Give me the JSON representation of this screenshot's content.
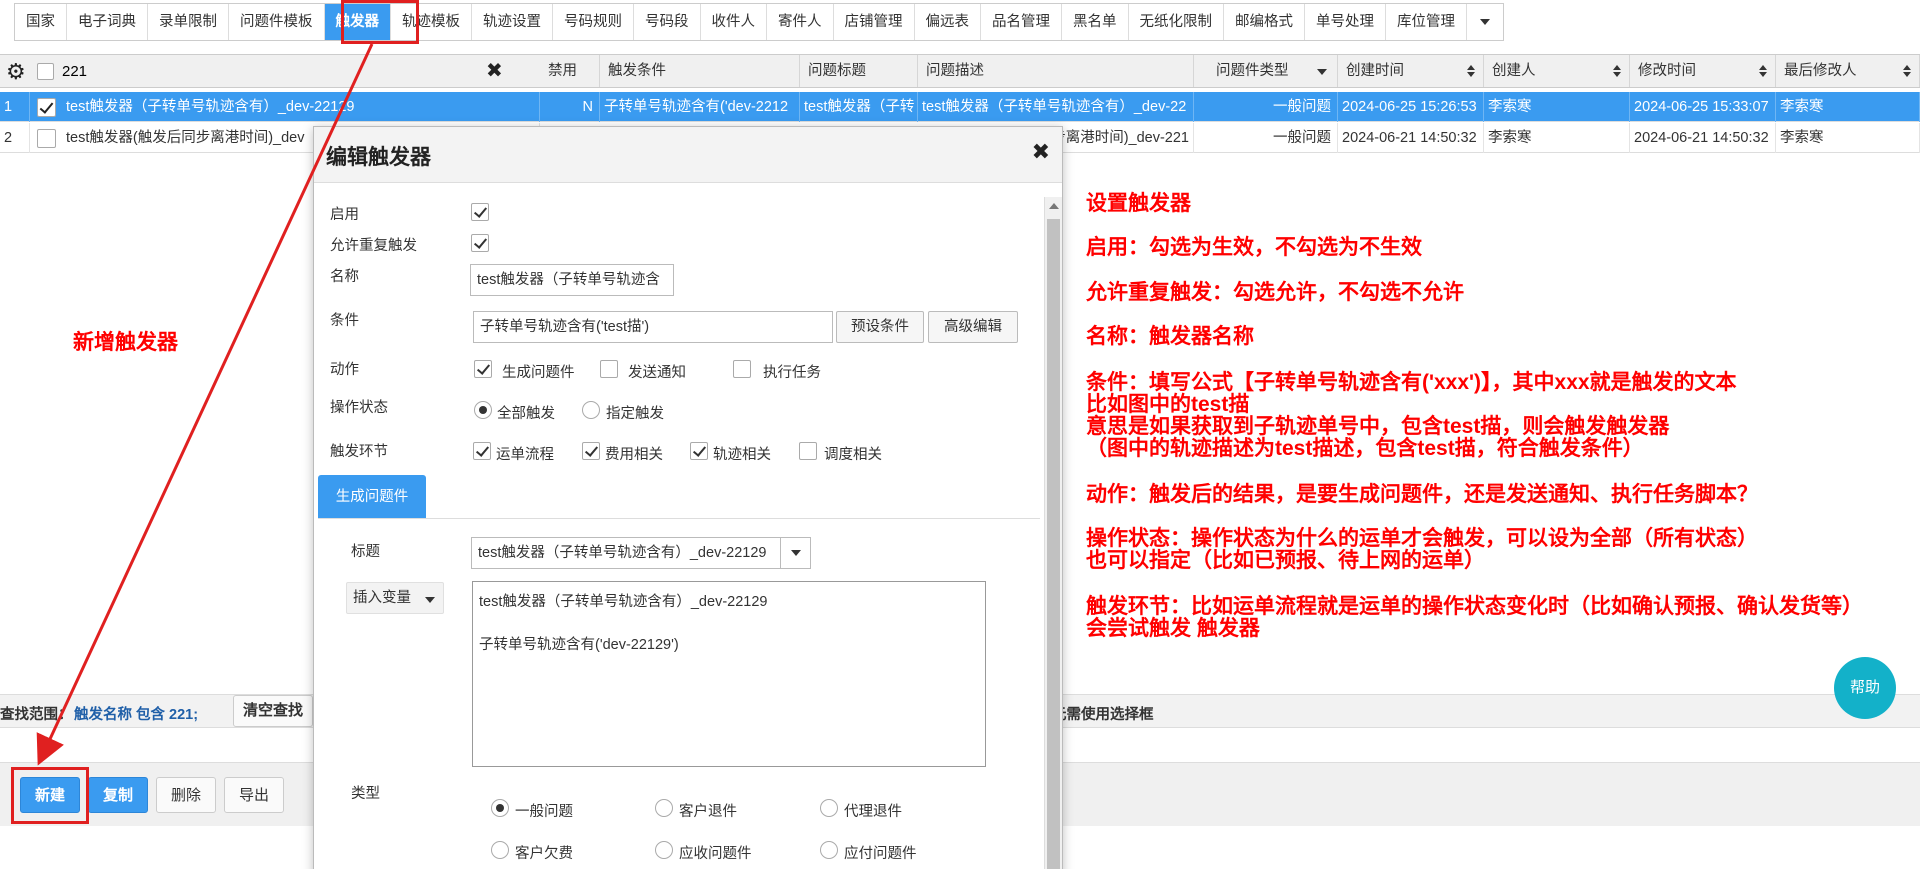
{
  "tabs": [
    "国家",
    "电子词典",
    "录单限制",
    "问题件模板",
    "触发器",
    "轨迹模板",
    "轨迹设置",
    "号码规则",
    "号码段",
    "收件人",
    "寄件人",
    "店铺管理",
    "偏远表",
    "品名管理",
    "黑名单",
    "无纸化限制",
    "邮编格式",
    "单号处理",
    "库位管理"
  ],
  "active_tab": "触发器",
  "table": {
    "search_value": "221",
    "headers": {
      "disabled": "禁用",
      "condition": "触发条件",
      "issue_title": "问题标题",
      "issue_desc": "问题描述",
      "issue_type": "问题件类型",
      "created_time": "创建时间",
      "creator": "创建人",
      "modified_time": "修改时间",
      "last_modifier": "最后修改人"
    },
    "rows": [
      {
        "num": "1",
        "name": "test触发器（子转单号轨迹含有）_dev-22129",
        "disabled": "N",
        "condition": "子转单号轨迹含有('dev-2212",
        "title": "test触发器（子转",
        "desc": "test触发器（子转单号轨迹含有）_dev-22",
        "type": "一般问题",
        "created": "2024-06-25 15:26:53",
        "creator": "李索寒",
        "modified": "2024-06-25 15:33:07",
        "modifier": "李索寒"
      },
      {
        "num": "2",
        "name": "test触发器(触发后同步离港时间)_dev",
        "disabled": "",
        "condition": "",
        "title": "",
        "desc": "步离港时间)_dev-221",
        "type": "一般问题",
        "created": "2024-06-21 14:50:32",
        "creator": "李索寒",
        "modified": "2024-06-21 14:50:32",
        "modifier": "李索寒"
      }
    ]
  },
  "filter": {
    "label": "查找范围：",
    "value": "触发名称 包含 221;",
    "clear_button": "清空查找",
    "tail_text": "元需使用选择框"
  },
  "actions": {
    "new": "新建",
    "copy": "复制",
    "delete": "删除",
    "export": "导出"
  },
  "help": "帮助",
  "modal": {
    "title": "编辑触发器",
    "enable_label": "启用",
    "repeat_label": "允许重复触发",
    "name_label": "名称",
    "name_value": "test触发器（子转单号轨迹含",
    "condition_label": "条件",
    "condition_value": "子转单号轨迹含有('test描')",
    "preset_button": "预设条件",
    "advanced_button": "高级编辑",
    "action_label": "动作",
    "action_options": [
      "生成问题件",
      "发送通知",
      "执行任务"
    ],
    "op_state_label": "操作状态",
    "op_state_options": [
      "全部触发",
      "指定触发"
    ],
    "stage_label": "触发环节",
    "stage_options": [
      "运单流程",
      "费用相关",
      "轨迹相关",
      "调度相关"
    ],
    "sub_tab": "生成问题件",
    "issue_title_label": "标题",
    "issue_title_value": "test触发器（子转单号轨迹含有）_dev-22129",
    "insert_var": "插入变量",
    "textarea_line1": "test触发器（子转单号轨迹含有）_dev-22129",
    "textarea_line2": "子转单号轨迹含有('dev-22129')",
    "type_label": "类型",
    "type_options": [
      "一般问题",
      "客户退件",
      "代理退件",
      "客户欠费",
      "应收问题件",
      "应付问题件"
    ]
  },
  "annotations": {
    "left": "新增触发器",
    "lines": [
      "设置触发器",
      "启用：勾选为生效，不勾选为不生效",
      "允许重复触发：勾选允许，不勾选不允许",
      "名称：触发器名称",
      "条件：填写公式【子转单号轨迹含有('xxx')】，其中xxx就是触发的文本",
      "比如图中的test描",
      "意思是如果获取到子轨迹单号中，包含test描，则会触发触发器",
      "（图中的轨迹描述为test描述，包含test描，符合触发条件）",
      "动作：触发后的结果，是要生成问题件，还是发送通知、执行任务脚本？",
      "操作状态：操作状态为什么的运单才会触发，可以设为全部（所有状态）",
      "也可以指定（比如已预报、待上网的运单）",
      "触发环节：比如运单流程就是运单的操作状态变化时（比如确认预报、确认发货等）",
      "会尝试触发 触发器"
    ]
  },
  "colors": {
    "accent": "#3a9bf0",
    "annotation": "#ff0000",
    "help": "#13b1c9"
  }
}
